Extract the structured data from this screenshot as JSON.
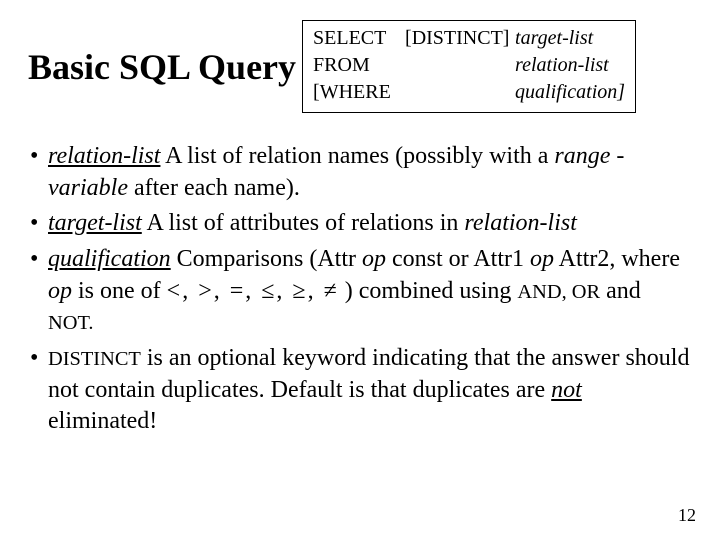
{
  "title": "Basic SQL Query",
  "syntax": {
    "r1_kw": "SELECT",
    "r1_opt": "[DISTINCT]",
    "r1_arg": "target-list",
    "r2_kw": "FROM",
    "r2_arg": "relation-list",
    "r3_kw": "[WHERE",
    "r3_arg": "qualification]"
  },
  "b1": {
    "term": "relation-list",
    "text1": "  A list of relation names (possibly with a ",
    "range": "range -variable",
    "text2": " after each name)."
  },
  "b2": {
    "term": "target-list",
    "text1": "  A list of attributes of relations in ",
    "rel": "relation-list"
  },
  "b3": {
    "term": "qualification",
    "text1": "  Comparisons (Attr ",
    "op1": "op",
    "text2": " const or Attr1 ",
    "op2": "op",
    "text3": " Attr2, where ",
    "op3": "op",
    "text4": " is one of  ",
    "ops": "<, >, =, ≤, ≥, ≠",
    "text5": " )  combined using ",
    "andornot": "AND, OR",
    "and_tx": " and ",
    "not_tx": "NOT."
  },
  "b4": {
    "kw": "DISTINCT",
    "text1": " is an optional keyword indicating that the answer should not contain duplicates.  Default is that duplicates are ",
    "not": "not",
    "text2": " eliminated!"
  },
  "pagenum": "12"
}
